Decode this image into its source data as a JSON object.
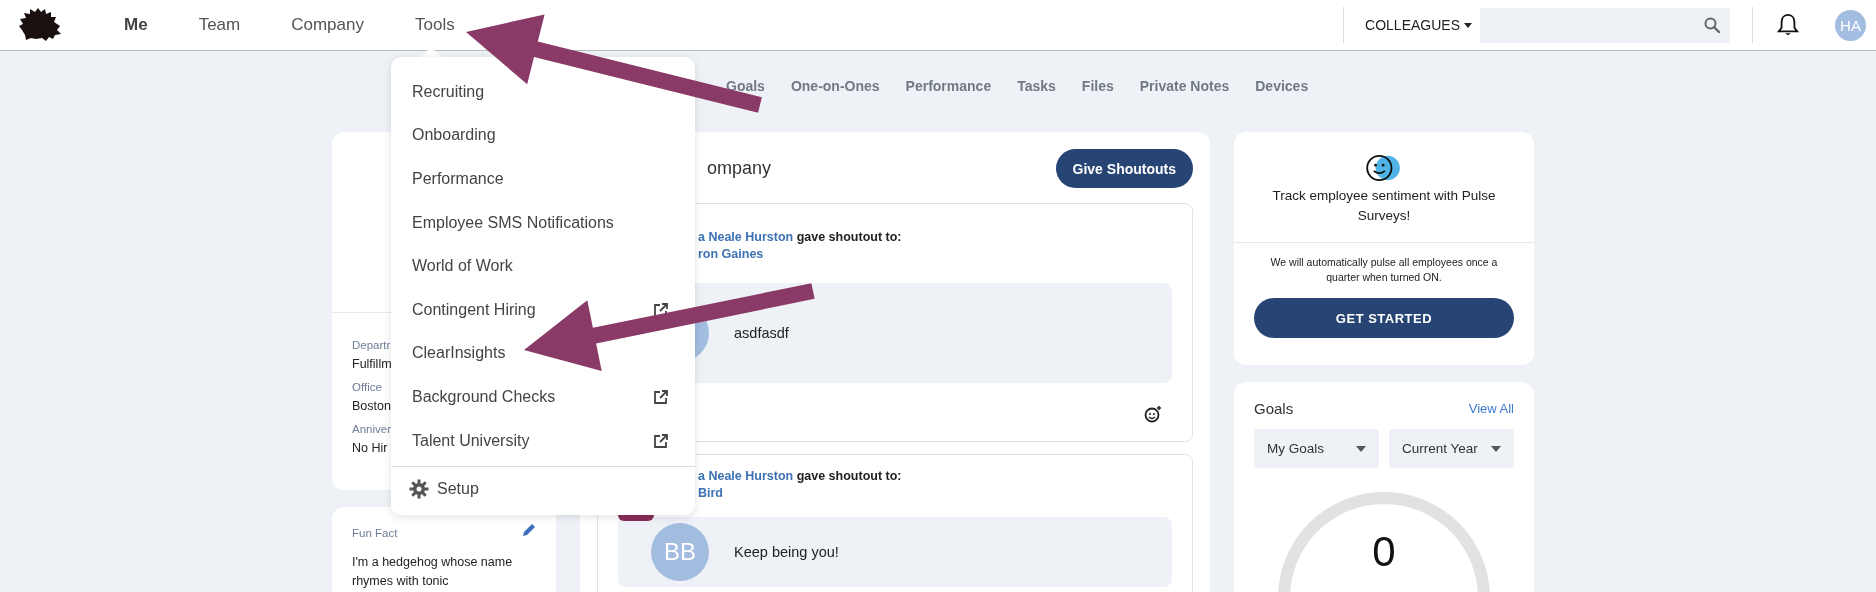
{
  "nav": {
    "items": [
      {
        "label": "Me",
        "selected": true
      },
      {
        "label": "Team",
        "selected": false
      },
      {
        "label": "Company",
        "selected": false
      },
      {
        "label": "Tools",
        "selected": false
      }
    ]
  },
  "colleagues": {
    "label": "COLLEAGUES"
  },
  "avatar": {
    "initials": "HA"
  },
  "subnav": [
    {
      "label": "Goals"
    },
    {
      "label": "One-on-Ones"
    },
    {
      "label": "Performance"
    },
    {
      "label": "Tasks"
    },
    {
      "label": "Files"
    },
    {
      "label": "Private Notes"
    },
    {
      "label": "Devices"
    }
  ],
  "tools_menu": {
    "items": [
      {
        "label": "Recruiting",
        "external": false
      },
      {
        "label": "Onboarding",
        "external": false
      },
      {
        "label": "Performance",
        "external": false
      },
      {
        "label": "Employee SMS Notifications",
        "external": false
      },
      {
        "label": "World of Work",
        "external": false
      },
      {
        "label": "Contingent Hiring",
        "external": true
      },
      {
        "label": "ClearInsights",
        "external": false
      },
      {
        "label": "Background Checks",
        "external": true
      },
      {
        "label": "Talent University",
        "external": true
      }
    ],
    "setup": "Setup"
  },
  "profile": {
    "fields": [
      {
        "label": "Departr",
        "value": "Fulfillm"
      },
      {
        "label": "Office",
        "value": "Boston"
      },
      {
        "label": "Anniver",
        "value": "No Hir"
      }
    ]
  },
  "fun_fact": {
    "title": "Fun Fact",
    "text": "I'm a hedgehog whose name rhymes with tonic"
  },
  "feed": {
    "title": "ompany",
    "button": "Give Shoutouts",
    "posts": [
      {
        "giver": "a Neale Hurston",
        "action": "gave shoutout to:",
        "recipient": "ron Gaines",
        "message": "asdfasdf"
      },
      {
        "giver": "a Neale Hurston",
        "action": "gave shoutout to:",
        "recipient": "Bird",
        "initials": "BB",
        "message": "Keep being you!"
      }
    ]
  },
  "pulse": {
    "headline": "Track employee sentiment with Pulse Surveys!",
    "note": "We will automatically pulse all employees once a quarter when turned ON.",
    "button": "GET STARTED"
  },
  "goals": {
    "title": "Goals",
    "link": "View All",
    "filters": [
      "My Goals",
      "Current Year"
    ],
    "count": "0"
  }
}
